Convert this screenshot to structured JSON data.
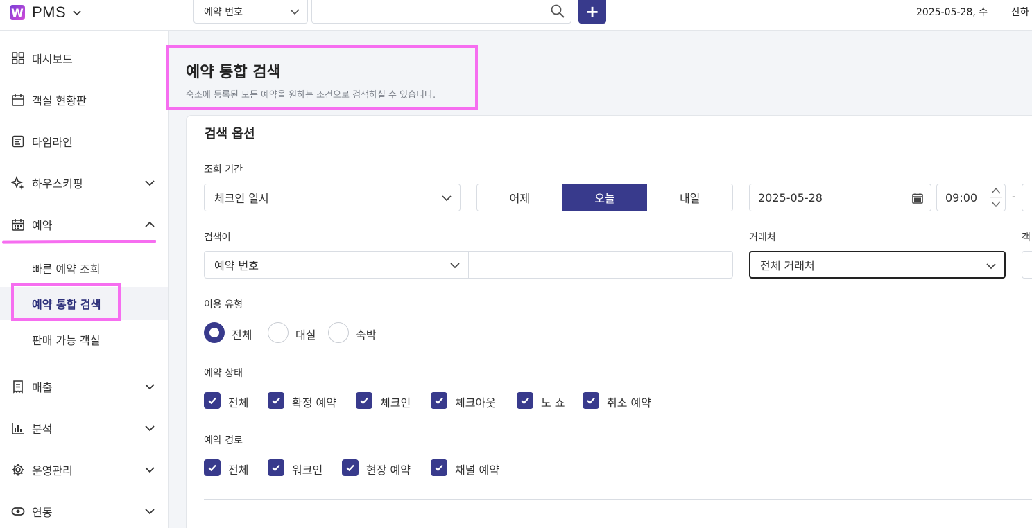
{
  "topbar": {
    "logo_text": "PMS",
    "search_select": "예약 번호",
    "search_value": "",
    "add_label": "+",
    "date": "2025-05-28, 수",
    "user": "산하"
  },
  "sidebar": {
    "items": [
      {
        "label": "대시보드",
        "icon": "grid-icon"
      },
      {
        "label": "객실 현황판",
        "icon": "calendar-board-icon"
      },
      {
        "label": "타임라인",
        "icon": "timeline-icon"
      },
      {
        "label": "하우스키핑",
        "icon": "sparkle-icon"
      },
      {
        "label": "예약",
        "icon": "calendar-icon"
      },
      {
        "label": "매출",
        "icon": "receipt-icon"
      },
      {
        "label": "분석",
        "icon": "bar-chart-icon"
      },
      {
        "label": "운영관리",
        "icon": "gear-icon"
      },
      {
        "label": "연동",
        "icon": "link-icon"
      }
    ],
    "sub_items": [
      "빠른 예약 조회",
      "예약 통합 검색",
      "판매 가능 객실"
    ]
  },
  "page": {
    "title": "예약 통합 검색",
    "description": "숙소에 등록된 모든 예약을 원하는 조건으로 검색하실 수 있습니다."
  },
  "search_options": {
    "header": "검색 옵션",
    "period_label": "조회 기간",
    "period_type": "체크인 일시",
    "day_buttons": [
      "어제",
      "오늘",
      "내일"
    ],
    "date_value": "2025-05-28",
    "time_value": "09:00",
    "dash": "-",
    "keyword_label": "검색어",
    "keyword_type": "예약 번호",
    "keyword_value": "",
    "partner_label": "거래처",
    "partner_value": "전체 거래처",
    "room_label": "객",
    "usage_label": "이용 유형",
    "usage_options": [
      "전체",
      "대실",
      "숙박"
    ],
    "status_label": "예약 상태",
    "status_options": [
      "전체",
      "확정 예약",
      "체크인",
      "체크아웃",
      "노 쇼",
      "취소 예약"
    ],
    "route_label": "예약 경로",
    "route_options": [
      "전체",
      "워크인",
      "현장 예약",
      "채널 예약"
    ]
  },
  "colors": {
    "primary": "#383a8c",
    "highlight": "#f66ef0"
  }
}
